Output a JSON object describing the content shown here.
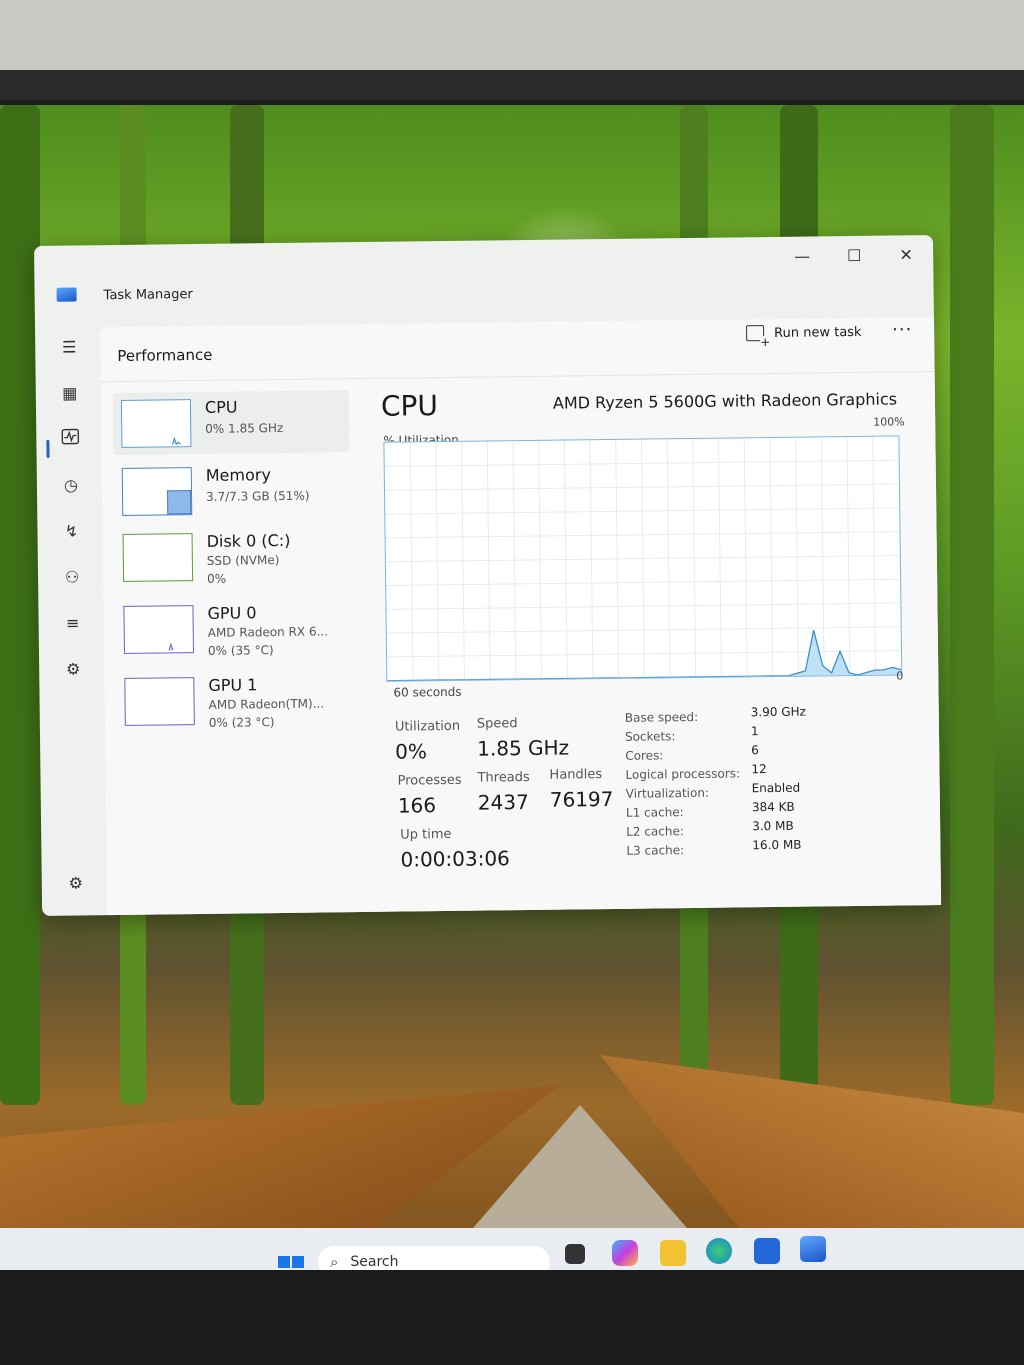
{
  "window": {
    "title": "Task Manager",
    "minimize": "—",
    "maximize": "☐",
    "close": "✕"
  },
  "header": {
    "title": "Performance",
    "run_task": "Run new task",
    "more": "···"
  },
  "sidebar_icons": [
    "hamburger-icon",
    "processes-icon",
    "performance-icon",
    "app-history-icon",
    "startup-apps-icon",
    "users-icon",
    "details-icon",
    "services-icon",
    "settings-icon"
  ],
  "devices": [
    {
      "name": "CPU",
      "sub1": "0% 1.85 GHz",
      "sub2": ""
    },
    {
      "name": "Memory",
      "sub1": "3.7/7.3 GB (51%)",
      "sub2": ""
    },
    {
      "name": "Disk 0 (C:)",
      "sub1": "SSD (NVMe)",
      "sub2": "0%"
    },
    {
      "name": "GPU 0",
      "sub1": "AMD Radeon RX 6...",
      "sub2": "0% (35 °C)"
    },
    {
      "name": "GPU 1",
      "sub1": "AMD Radeon(TM)...",
      "sub2": "0% (23 °C)"
    }
  ],
  "cpu": {
    "title": "CPU",
    "model": "AMD Ryzen 5 5600G with Radeon Graphics",
    "util_label": "% Utilization",
    "max_label": "100%",
    "min_label": "0",
    "time_label": "60 seconds",
    "stats": {
      "utilization_label": "Utilization",
      "utilization": "0%",
      "speed_label": "Speed",
      "speed": "1.85 GHz",
      "processes_label": "Processes",
      "processes": "166",
      "threads_label": "Threads",
      "threads": "2437",
      "handles_label": "Handles",
      "handles": "76197",
      "uptime_label": "Up time",
      "uptime": "0:00:03:06"
    },
    "specs": [
      {
        "label": "Base speed:",
        "value": "3.90 GHz"
      },
      {
        "label": "Sockets:",
        "value": "1"
      },
      {
        "label": "Cores:",
        "value": "6"
      },
      {
        "label": "Logical processors:",
        "value": "12"
      },
      {
        "label": "Virtualization:",
        "value": "Enabled"
      },
      {
        "label": "L1 cache:",
        "value": "384 KB"
      },
      {
        "label": "L2 cache:",
        "value": "3.0 MB"
      },
      {
        "label": "L3 cache:",
        "value": "16.0 MB"
      }
    ],
    "history": [
      0,
      0,
      0,
      0,
      0,
      0,
      0,
      0,
      0,
      0,
      0,
      0,
      0,
      0,
      0,
      0,
      0,
      0,
      0,
      0,
      0,
      0,
      0,
      0,
      0,
      0,
      0,
      0,
      0,
      0,
      0,
      0,
      0,
      0,
      0,
      0,
      0,
      0,
      0,
      0,
      0,
      0,
      0,
      0,
      0,
      0,
      0,
      1,
      2,
      19,
      4,
      1,
      10,
      1,
      0,
      1,
      2,
      2,
      3,
      2
    ]
  },
  "taskbar": {
    "search_placeholder": "Search"
  },
  "colors": {
    "accent": "#1f63c7",
    "graph_line": "#3a8fcf",
    "graph_fill": "#bfe0f5"
  }
}
